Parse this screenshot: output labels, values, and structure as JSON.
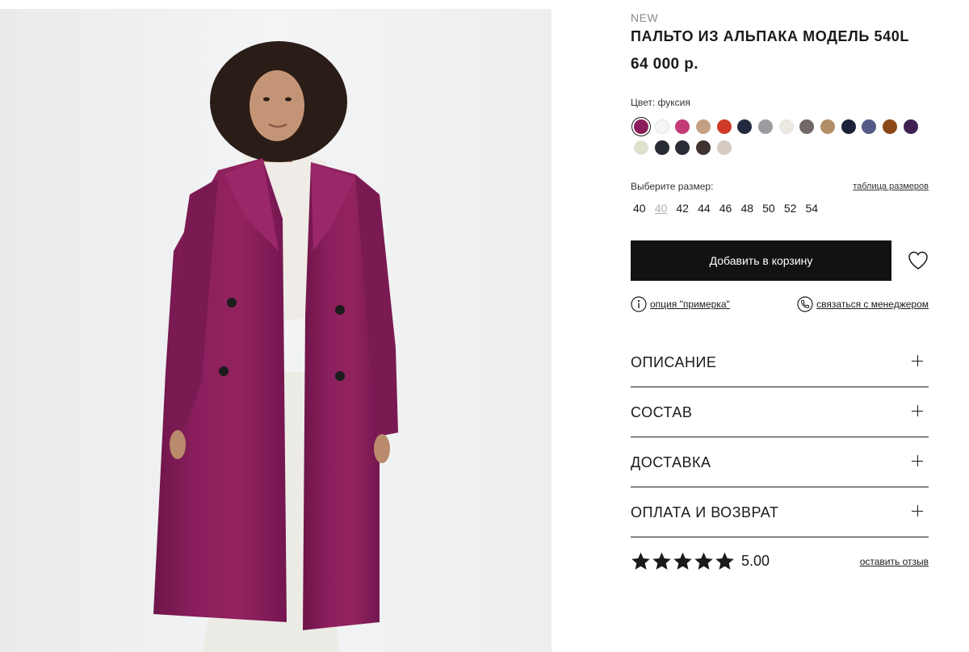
{
  "product": {
    "badge": "NEW",
    "title": "ПАЛЬТО ИЗ АЛЬПАКА МОДЕЛЬ 540L",
    "price": "64 000 р."
  },
  "color": {
    "label": "Цвет: фуксия",
    "selected_index": 0,
    "swatches": [
      "#8a1e5c",
      "#f5f5f3",
      "#c23a78",
      "#c4a083",
      "#cf3b28",
      "#232a3f",
      "#9a9ca0",
      "#ece8e2",
      "#726868",
      "#b28e69",
      "#1c2238",
      "#545b86",
      "#8a4717",
      "#3f2053",
      "#dfe2cb",
      "#262b33",
      "#2a2d34",
      "#3f3330",
      "#d6cbc3"
    ]
  },
  "size": {
    "label": "Выберите размер:",
    "table_link": "таблица размеров",
    "options": [
      {
        "label": "40",
        "available": true
      },
      {
        "label": "40",
        "available": false
      },
      {
        "label": "42",
        "available": true
      },
      {
        "label": "44",
        "available": true
      },
      {
        "label": "46",
        "available": true
      },
      {
        "label": "48",
        "available": true
      },
      {
        "label": "50",
        "available": true
      },
      {
        "label": "52",
        "available": true
      },
      {
        "label": "54",
        "available": true
      }
    ]
  },
  "actions": {
    "add_to_cart": "Добавить в корзину",
    "try_on": "опция \"примерка\"",
    "contact_manager": "связаться с менеджером"
  },
  "accordion": [
    {
      "label": "ОПИСАНИЕ"
    },
    {
      "label": "СОСТАВ"
    },
    {
      "label": "ДОСТАВКА"
    },
    {
      "label": "ОПЛАТА И ВОЗВРАТ"
    }
  ],
  "rating": {
    "stars": 5,
    "score": "5.00",
    "review_link": "оставить отзыв"
  },
  "colors": {
    "coat": "#8c1f5e",
    "button_bg": "#121212"
  }
}
